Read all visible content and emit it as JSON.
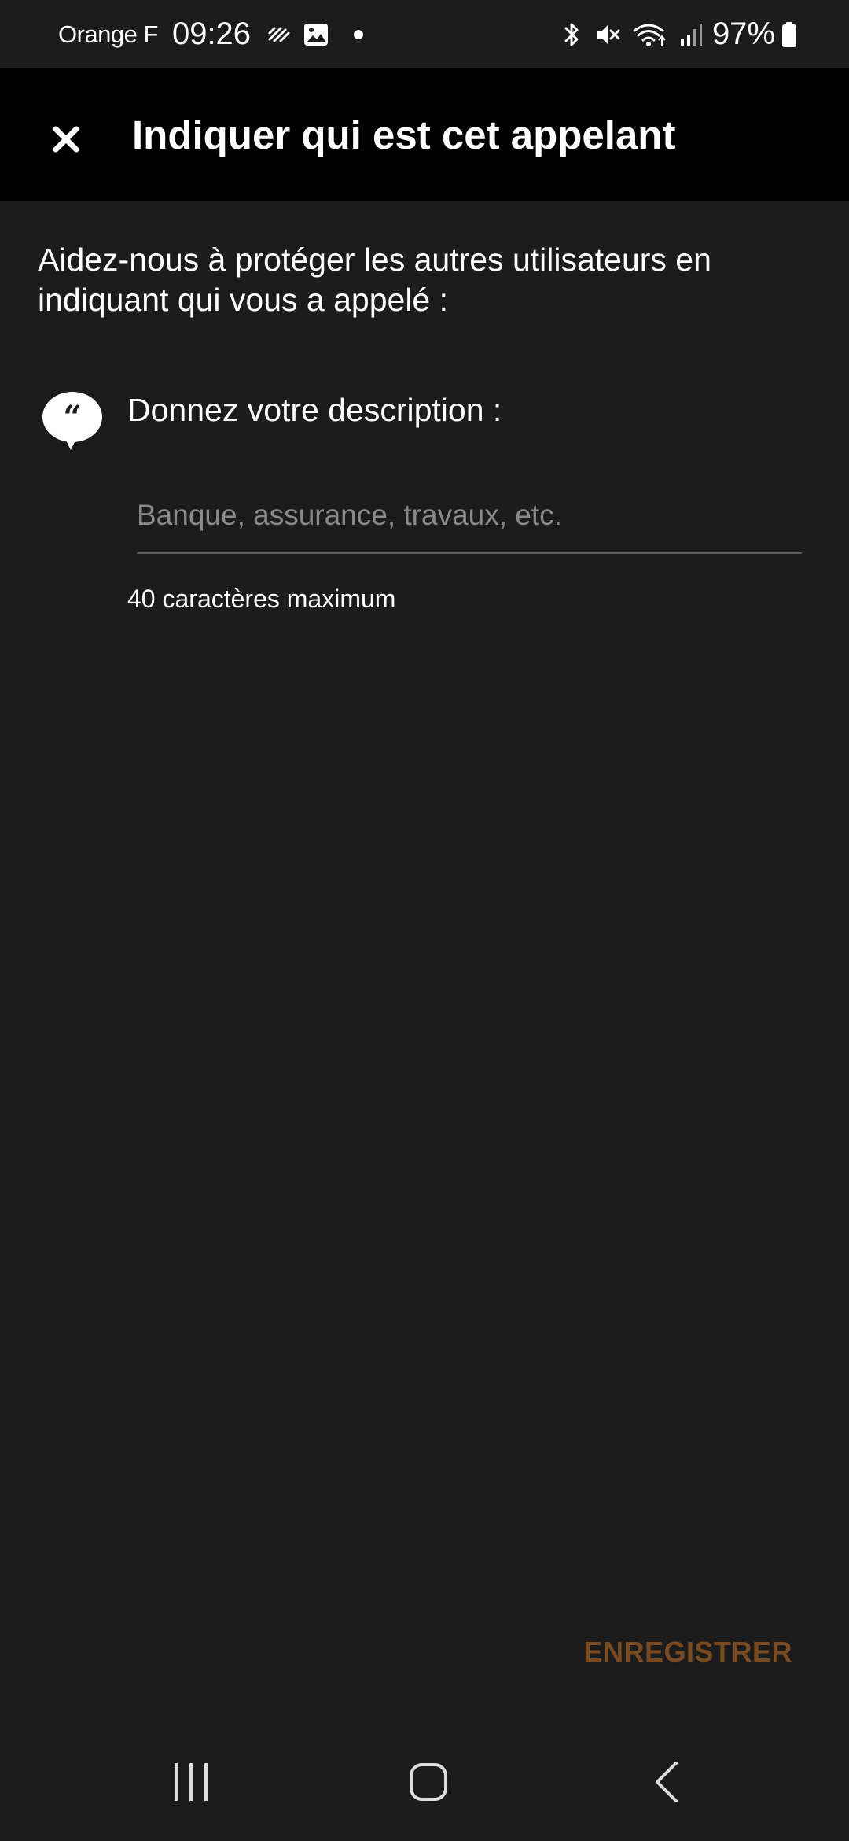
{
  "status_bar": {
    "carrier": "Orange F",
    "time": "09:26",
    "battery": "97%",
    "left_icons": [
      "network-activity-icon",
      "gallery-icon",
      "notification-dot-icon"
    ],
    "right_icons": [
      "bluetooth-icon",
      "mute-icon",
      "wifi-icon",
      "signal-icon",
      "battery-icon"
    ]
  },
  "app_bar": {
    "close_icon": "close-icon",
    "title": "Indiquer qui est cet appelant"
  },
  "content": {
    "intro": "Aidez-nous à protéger les autres utilisateurs en indiquant qui vous a appelé :",
    "description_icon": "quote-bubble-icon",
    "description_label": "Donnez votre description :",
    "description_input": {
      "value": "",
      "placeholder": "Banque, assurance, travaux, etc."
    },
    "helper": "40 caractères maximum"
  },
  "actions": {
    "save_label": "ENREGISTRER"
  },
  "nav_bar": {
    "buttons": [
      "recents-icon",
      "home-icon",
      "back-icon"
    ]
  },
  "colors": {
    "background": "#1c1c1c",
    "app_bar": "#000000",
    "text": "#ffffff",
    "placeholder": "#8a8a8a",
    "save_button": "#7a4a22",
    "underline": "#5a5a5a"
  }
}
